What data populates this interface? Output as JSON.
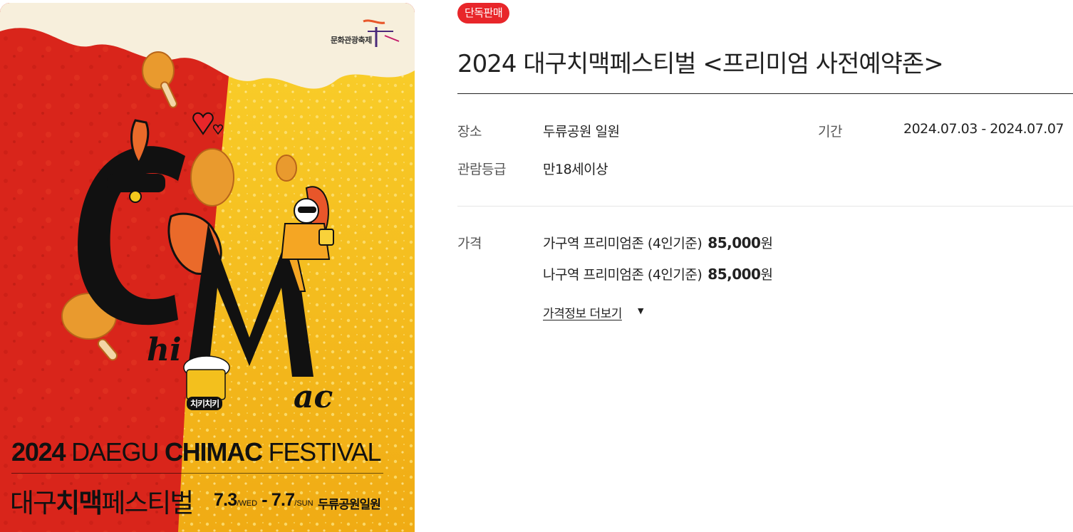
{
  "poster": {
    "logo_text": "문화관광축제",
    "word_hi": "hi",
    "word_ac": "ac",
    "badge_text": "치키치키",
    "title_en_year": "2024",
    "title_en_light": "DAEGU",
    "title_en_bold": "CHIMAC",
    "title_en_end": "FESTIVAL",
    "title_ko_pre": "대구",
    "title_ko_bold": "치맥",
    "title_ko_post": "페스티벌",
    "date_start": "7.3",
    "date_start_day": "/WED",
    "date_sep": " - ",
    "date_end": "7.7",
    "date_end_day": "/SUN",
    "venue": "두류공원일원",
    "colors": {
      "red": "#d9251b",
      "yellow": "#f5c21a",
      "foam": "#f7efdc"
    }
  },
  "badge": {
    "label": "단독판매",
    "color": "#e8262a"
  },
  "title": "2024 대구치맥페스티벌 <프리미엄 사전예약존>",
  "info": {
    "venue_label": "장소",
    "venue_value": "두류공원 일원",
    "period_label": "기간",
    "period_value": "2024.07.03 - 2024.07.07",
    "rating_label": "관람등급",
    "rating_value": "만18세이상"
  },
  "price": {
    "label": "가격",
    "items": [
      {
        "name": "가구역 프리미엄존 (4인기준)",
        "amount": "85,000",
        "unit": "원"
      },
      {
        "name": "나구역 프리미엄존 (4인기준)",
        "amount": "85,000",
        "unit": "원"
      }
    ],
    "more_label": "가격정보 더보기",
    "more_icon": "caret-down-icon"
  }
}
